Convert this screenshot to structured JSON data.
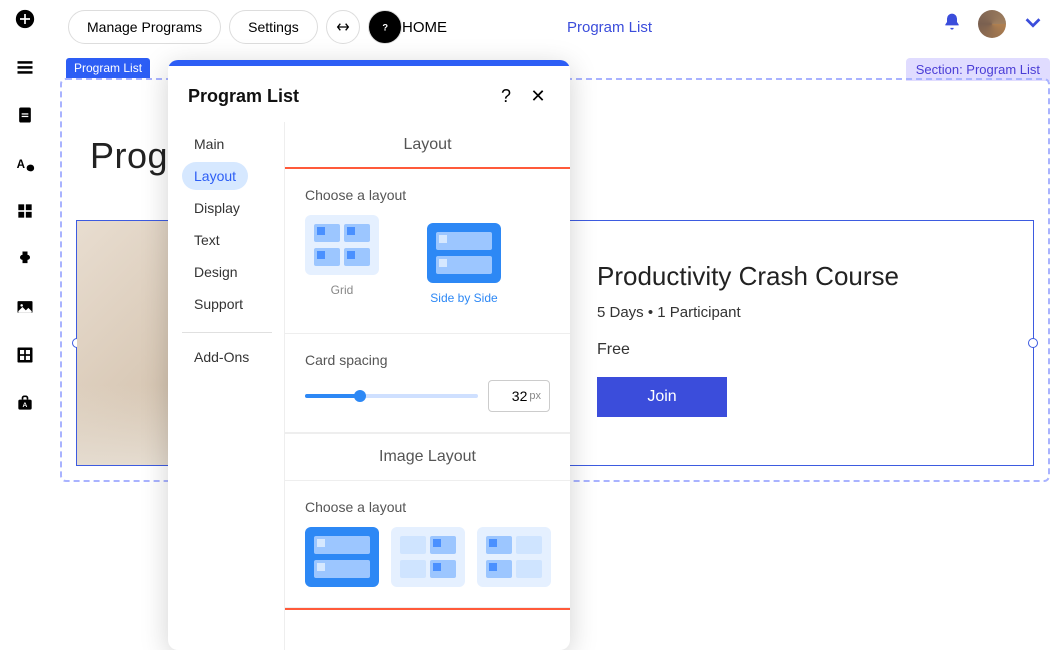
{
  "rail": [
    "add",
    "page",
    "doc",
    "style",
    "apps",
    "plugins",
    "image",
    "table",
    "store"
  ],
  "toolbar": {
    "manage": "Manage Programs",
    "settings": "Settings"
  },
  "nav": {
    "home": "HOME",
    "program_list": "Program List"
  },
  "badges": {
    "left": "Program List",
    "right": "Section: Program List"
  },
  "section_title": "Programs",
  "card": {
    "title": "Productivity Crash Course",
    "meta": "5 Days • 1 Participant",
    "price": "Free",
    "cta": "Join"
  },
  "popover": {
    "title": "Program List",
    "tabs": [
      "Main",
      "Layout",
      "Display",
      "Text",
      "Design",
      "Support"
    ],
    "addons": "Add-Ons",
    "active_tab": "Layout",
    "headings": {
      "layout": "Layout",
      "choose": "Choose a layout",
      "card_spacing": "Card spacing",
      "image_layout": "Image Layout",
      "choose2": "Choose a layout"
    },
    "layout_opts": [
      {
        "label": "Grid",
        "selected": false
      },
      {
        "label": "Side by Side",
        "selected": true
      }
    ],
    "card_spacing": {
      "value": "32",
      "unit": "px"
    },
    "image_layout_opts": [
      {
        "selected": true
      },
      {
        "selected": false
      },
      {
        "selected": false
      }
    ]
  }
}
